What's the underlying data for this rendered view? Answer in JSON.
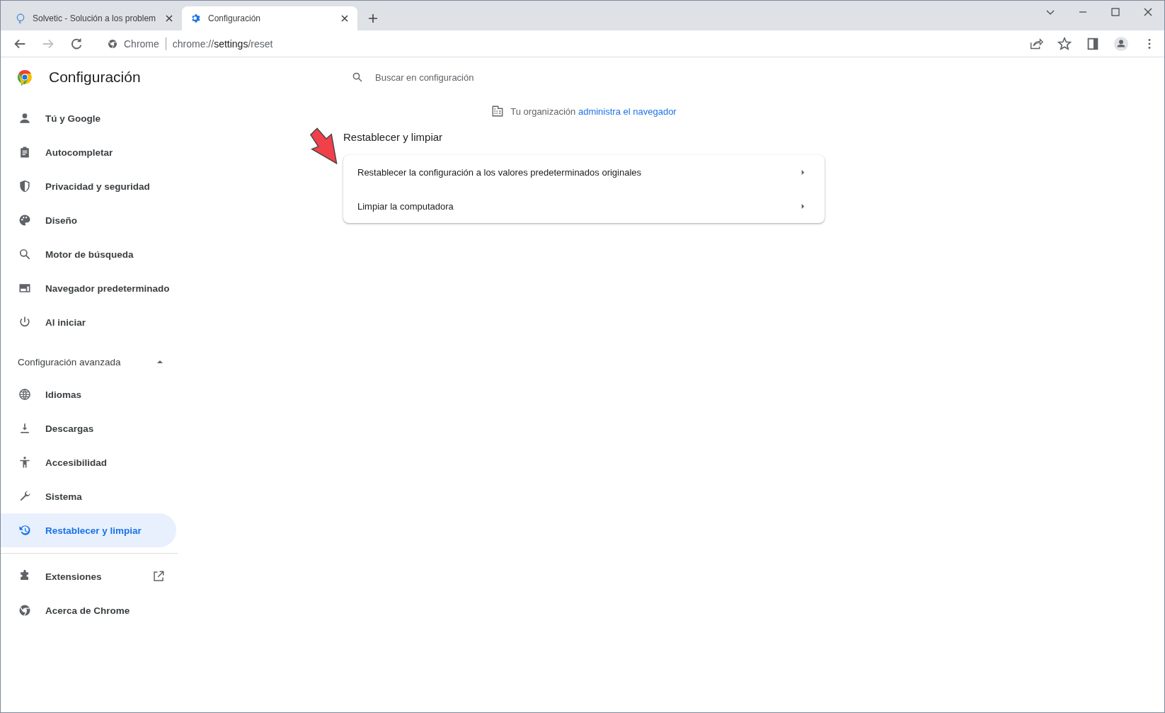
{
  "tabs": [
    {
      "title": "Solvetic - Solución a los problem",
      "selected": false
    },
    {
      "title": "Configuración",
      "selected": true
    }
  ],
  "address_bar": {
    "site_label": "Chrome",
    "url_scheme": "chrome://",
    "url_host": "settings",
    "url_path": "/reset"
  },
  "app": {
    "title": "Configuración",
    "search_placeholder": "Buscar en configuración"
  },
  "sidebar": {
    "items": [
      {
        "label": "Tú y Google",
        "selected": false
      },
      {
        "label": "Autocompletar",
        "selected": false
      },
      {
        "label": "Privacidad y seguridad",
        "selected": false
      },
      {
        "label": "Diseño",
        "selected": false
      },
      {
        "label": "Motor de búsqueda",
        "selected": false
      },
      {
        "label": "Navegador predeterminado",
        "selected": false
      },
      {
        "label": "Al iniciar",
        "selected": false
      }
    ],
    "advanced": {
      "label": "Configuración avanzada",
      "expanded": true,
      "items": [
        {
          "label": "Idiomas",
          "selected": false
        },
        {
          "label": "Descargas",
          "selected": false
        },
        {
          "label": "Accesibilidad",
          "selected": false
        },
        {
          "label": "Sistema",
          "selected": false
        },
        {
          "label": "Restablecer y limpiar",
          "selected": true
        }
      ]
    },
    "footer_items": [
      {
        "label": "Extensiones",
        "external": true
      },
      {
        "label": "Acerca de Chrome",
        "external": false
      }
    ]
  },
  "org_notice": {
    "text": "Tu organización",
    "link": "administra el navegador"
  },
  "section": {
    "title": "Restablecer y limpiar",
    "rows": [
      {
        "label": "Restablecer la configuración a los valores predeterminados originales"
      },
      {
        "label": "Limpiar la computadora"
      }
    ]
  }
}
